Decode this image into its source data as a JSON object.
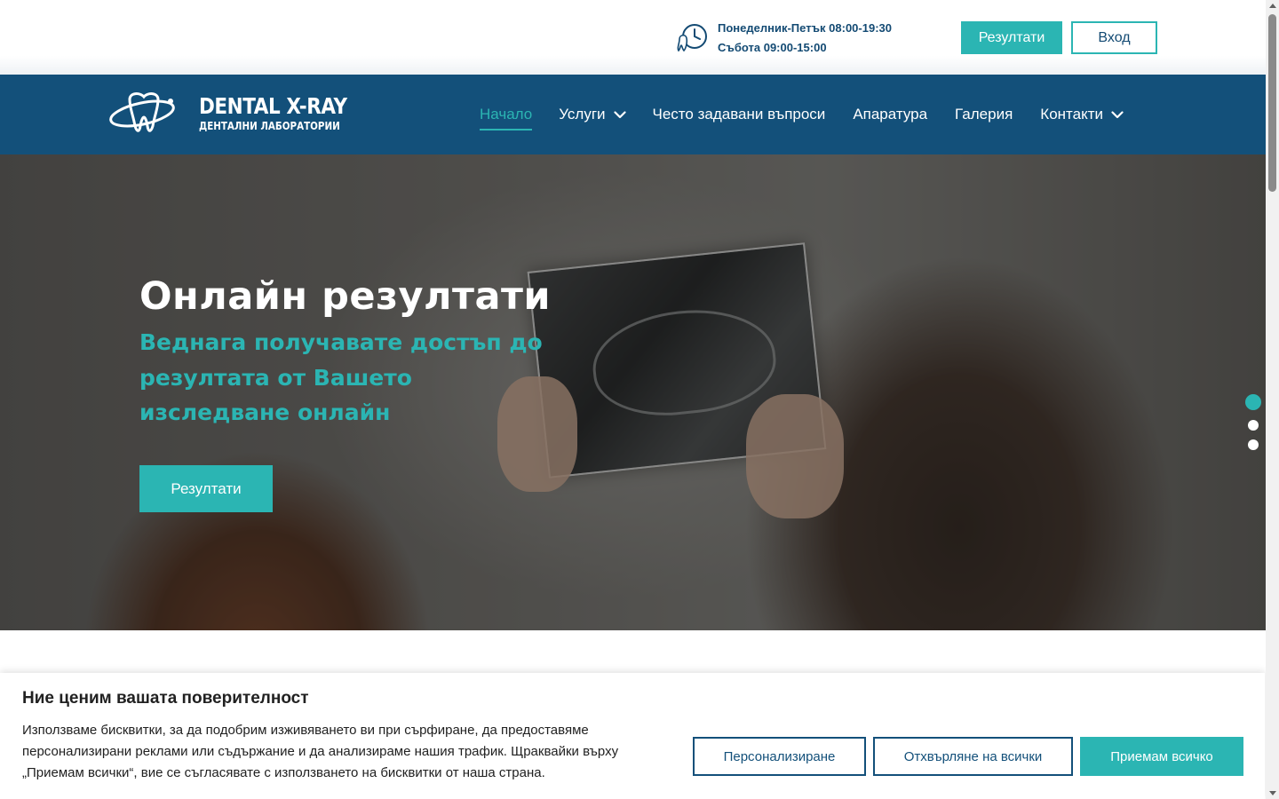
{
  "topbar": {
    "hours_weekdays": "Понеделник-Петък 08:00-19:30",
    "hours_saturday": "Събота 09:00-15:00",
    "results_button": "Резултати",
    "login_button": "Вход"
  },
  "logo": {
    "title": "DENTAL X-RAY",
    "subtitle": "ДЕНТАЛНИ ЛАБОРАТОРИИ"
  },
  "nav": {
    "items": [
      {
        "label": "Начало",
        "active": true,
        "dropdown": false
      },
      {
        "label": "Услуги",
        "active": false,
        "dropdown": true
      },
      {
        "label": "Често задавани въпроси",
        "active": false,
        "dropdown": false
      },
      {
        "label": "Апаратура",
        "active": false,
        "dropdown": false
      },
      {
        "label": "Галерия",
        "active": false,
        "dropdown": false
      },
      {
        "label": "Контакти",
        "active": false,
        "dropdown": true
      }
    ]
  },
  "hero": {
    "title": "Онлайн резултати",
    "subtitle": "Веднага получавате достъп до резултата от Вашето изследване онлайн",
    "button": "Резултати",
    "slides_total": 3,
    "active_slide": 1
  },
  "cookie": {
    "title": "Ние ценим вашата поверителност",
    "text": "Използваме бисквитки, за да подобрим изживяването ви при сърфиране, да предоставяме персонализирани реклами или съдържание и да анализираме нашия трафик. Щраквайки върху „Приемам всички“, вие се съгласявате с използването на бисквитки от наша страна.",
    "customize_button": "Персонализиране",
    "reject_button": "Отхвърляне на всички",
    "accept_button": "Приемам всичко"
  },
  "colors": {
    "accent": "#2bb5b3",
    "brand": "#13507a",
    "hours_text": "#134a73"
  }
}
